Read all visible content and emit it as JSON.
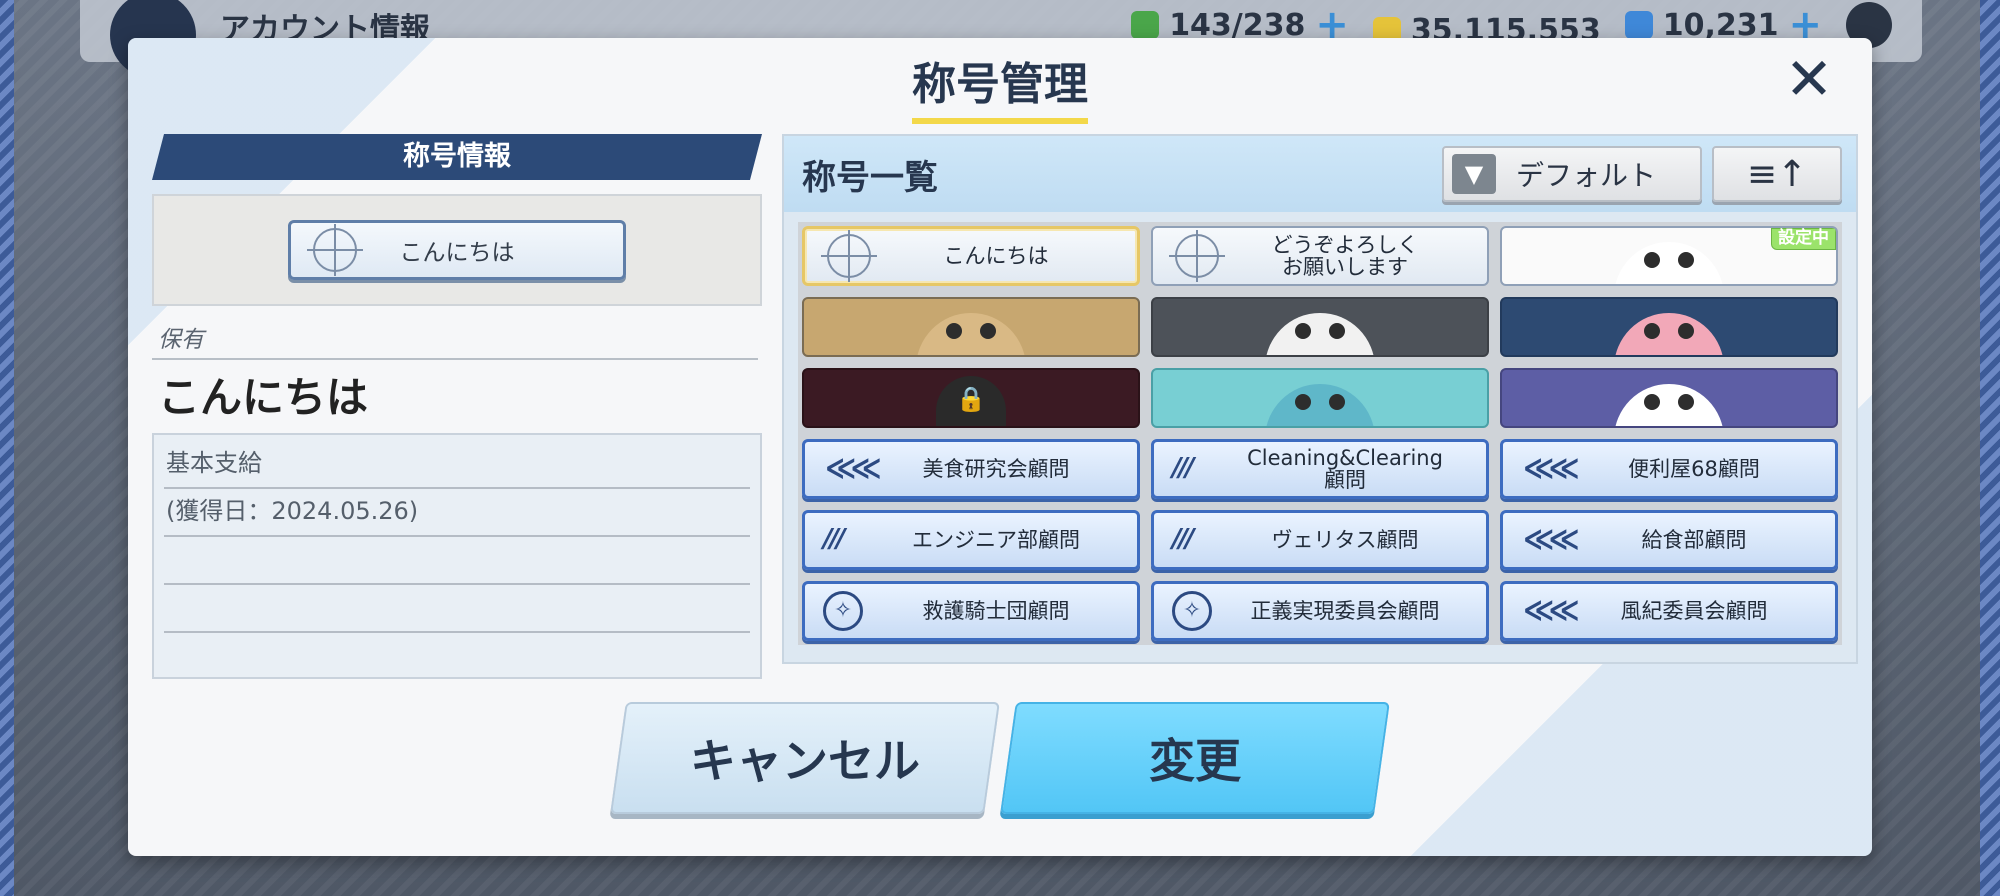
{
  "topbar": {
    "title": "アカウント情報",
    "resources": [
      {
        "name": "ap",
        "value": "143/238"
      },
      {
        "name": "credits",
        "value": "35,115,553"
      },
      {
        "name": "pyroxene",
        "value": "10,231"
      }
    ],
    "plus": "+"
  },
  "dialog": {
    "title": "称号管理",
    "close": "✕"
  },
  "left": {
    "header": "称号情報",
    "preview_title": "こんにちは",
    "owned_label": "保有",
    "owned_name": "こんにちは",
    "info_lines": [
      "基本支給",
      "(獲得日：2024.05.26)",
      "",
      "",
      ""
    ]
  },
  "right": {
    "header": "称号一覧",
    "filter_icon": "▼",
    "filter_label": "デフォルト",
    "sort_icon": "≡↑",
    "set_badge": "設定中",
    "titles": [
      {
        "label": "こんにちは",
        "style": "plain",
        "icon": "reticle",
        "selected": true
      },
      {
        "label": "どうぞよろしく\nお願いします",
        "style": "plain",
        "icon": "reticle",
        "selected": false
      },
      {
        "label": "",
        "style": "critter-white",
        "icon": "bird-face",
        "selected": false,
        "equipped": true
      },
      {
        "label": "",
        "style": "critter-dog",
        "icon": "dog-face",
        "selected": false
      },
      {
        "label": "",
        "style": "critter-dark",
        "icon": "skull-face",
        "selected": false
      },
      {
        "label": "",
        "style": "critter-navy",
        "icon": "pink-bird-face",
        "selected": false
      },
      {
        "label": "",
        "style": "critter-maroon",
        "icon": "lock-icon",
        "selected": false
      },
      {
        "label": "",
        "style": "critter-teal",
        "icon": "owl-face",
        "selected": false
      },
      {
        "label": "",
        "style": "critter-purple",
        "icon": "cat-face",
        "selected": false
      },
      {
        "label": "美食研究会顧問",
        "style": "blue",
        "icon": "chevron",
        "selected": false
      },
      {
        "label": "Cleaning&Clearing\n顧問",
        "style": "blue",
        "icon": "millennium",
        "selected": false
      },
      {
        "label": "便利屋68顧問",
        "style": "blue",
        "icon": "chevron",
        "selected": false
      },
      {
        "label": "エンジニア部顧問",
        "style": "blue",
        "icon": "millennium",
        "selected": false
      },
      {
        "label": "ヴェリタス顧問",
        "style": "blue",
        "icon": "millennium",
        "selected": false
      },
      {
        "label": "給食部顧問",
        "style": "blue",
        "icon": "chevron",
        "selected": false
      },
      {
        "label": "救護騎士団顧問",
        "style": "blue",
        "icon": "trinity",
        "selected": false
      },
      {
        "label": "正義実現委員会顧問",
        "style": "blue",
        "icon": "trinity",
        "selected": false
      },
      {
        "label": "風紀委員会顧問",
        "style": "blue",
        "icon": "chevron",
        "selected": false
      }
    ]
  },
  "buttons": {
    "cancel": "キャンセル",
    "confirm": "変更"
  }
}
